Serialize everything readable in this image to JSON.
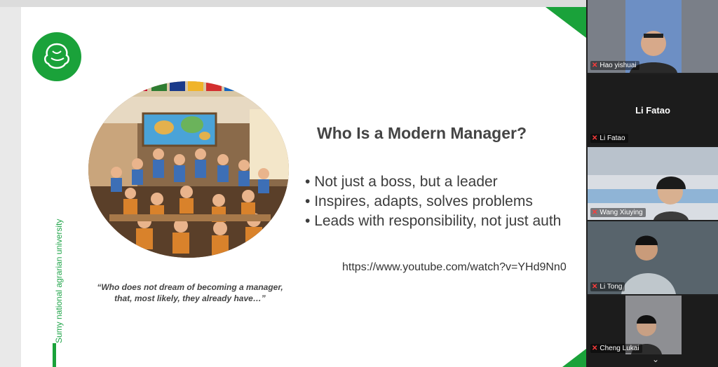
{
  "slide": {
    "title": "Who Is a Modern Manager?",
    "bullets": [
      "Not just a boss, but a leader",
      "Inspires, adapts, solves problems",
      "Leads with responsibility, not just auth"
    ],
    "link": "https://www.youtube.com/watch?v=YHd9Nn0",
    "quote_line1": "“Who does not dream of becoming a manager,",
    "quote_line2": "that, most likely, they already have…”",
    "vertical_caption": "Sumy national agrarian university",
    "accent_color": "#1aa23a"
  },
  "participants": [
    {
      "name": "Hao yishuai",
      "video": true,
      "muted": true
    },
    {
      "name": "Li Fatao",
      "video": false,
      "muted": true,
      "display_name": "Li Fatao"
    },
    {
      "name": "Wang Xiuying",
      "video": true,
      "muted": true
    },
    {
      "name": "Li Tong",
      "video": true,
      "muted": true
    },
    {
      "name": "Cheng Lukai",
      "video": true,
      "muted": true
    }
  ],
  "icons": {
    "mic": "mic-muted-icon",
    "expand": "chevron-down-icon",
    "logo": "university-logo"
  }
}
